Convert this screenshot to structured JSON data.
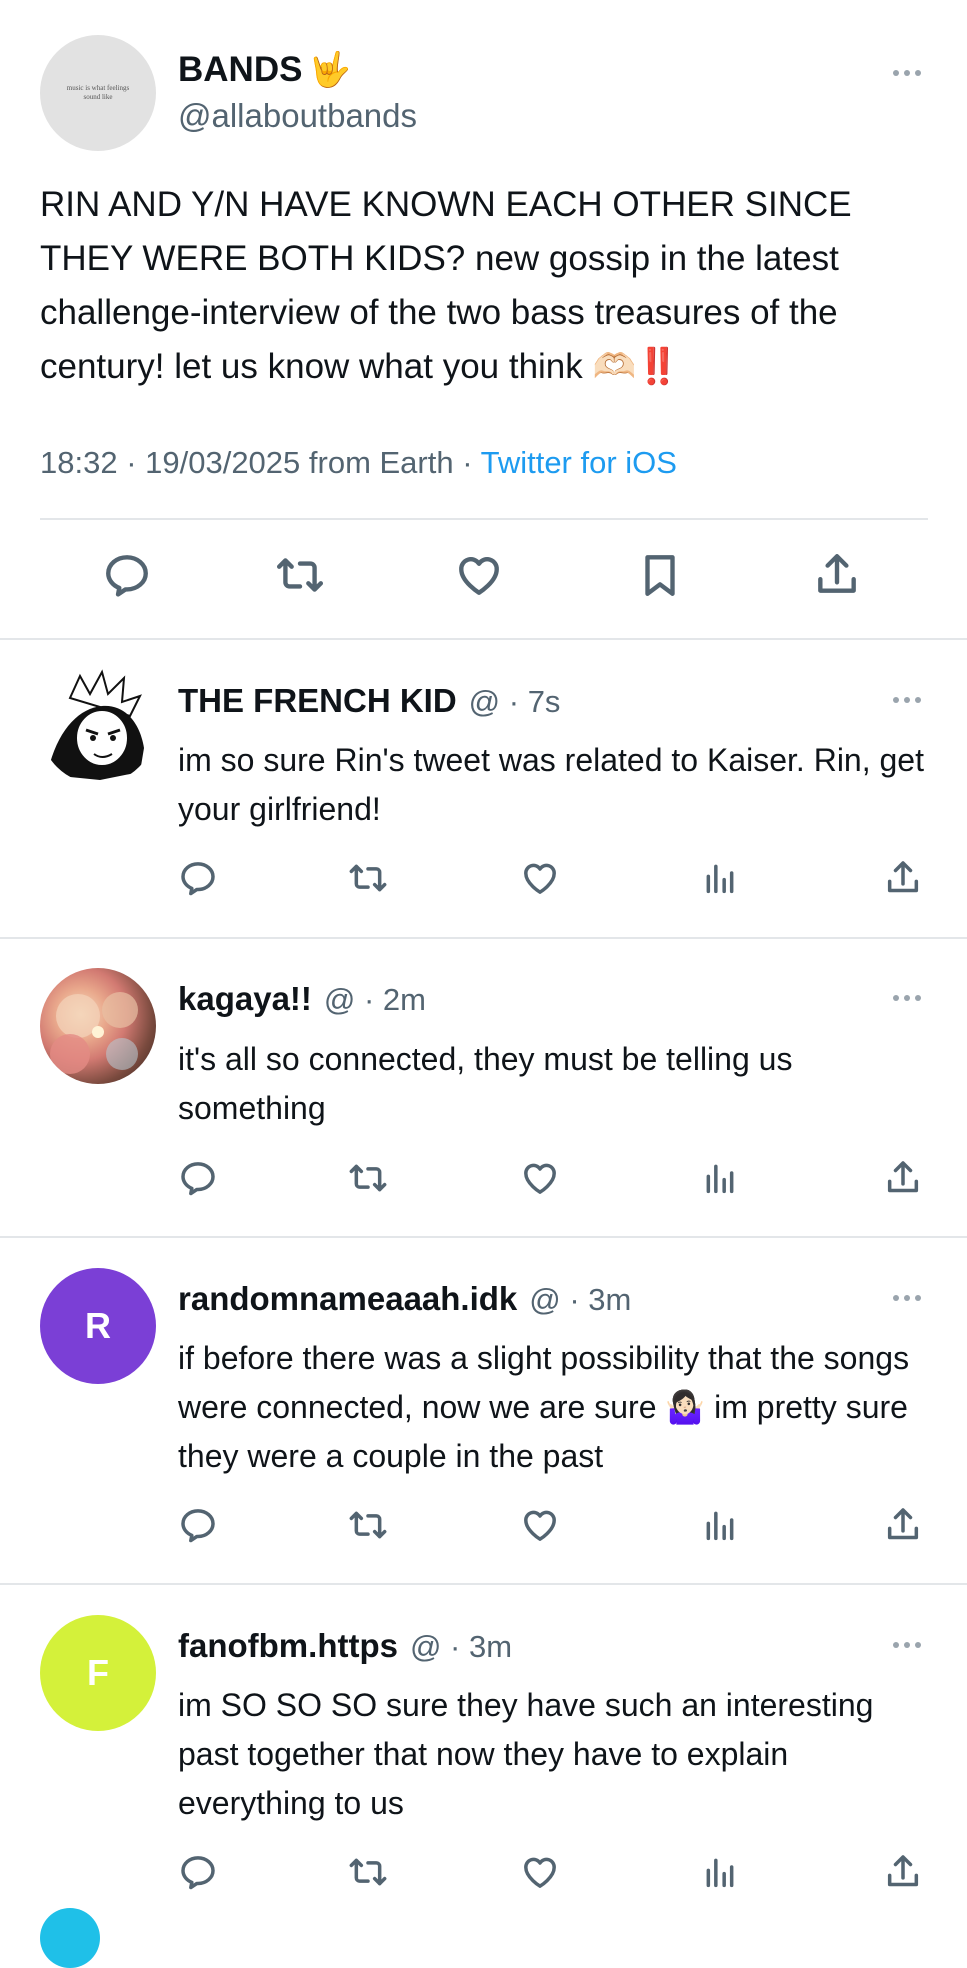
{
  "main_tweet": {
    "author_name": "BANDS",
    "author_emoji": "🤟",
    "handle": "@allaboutbands",
    "avatar_text": "music is what feelings sound like",
    "text": "RIN AND Y/N HAVE KNOWN EACH OTHER SINCE THEY WERE BOTH KIDS? new gossip in the latest challenge-interview of the two bass treasures of the century! let us know what you think 🫶🏻‼️",
    "timestamp": "18:32 · 19/03/2025 from Earth · ",
    "source": "Twitter for iOS",
    "actions": [
      "reply-icon",
      "retweet-icon",
      "like-icon",
      "bookmark-icon",
      "share-icon"
    ]
  },
  "replies": [
    {
      "name": "THE FRENCH KID",
      "meta": "@ · 7s",
      "text": "im so sure Rin's tweet was related to Kaiser. Rin, get your girlfriend!",
      "avatar_type": "manga-drawing"
    },
    {
      "name": "kagaya!!",
      "meta": "@ · 2m",
      "text": "it's all so connected, they must be telling us something",
      "avatar_type": "lanterns-photo"
    },
    {
      "name": "randomnameaaah.idk",
      "meta": "@ · 3m",
      "text": "if before there was a slight possibility that the songs were connected, now we are sure 🤷🏻‍♀️ im pretty sure they were a couple in the past",
      "avatar_letter": "R",
      "avatar_color": "#7b3fd6"
    },
    {
      "name": "fanofbm.https",
      "meta": "@ · 3m",
      "text": "im SO SO SO sure they have such an interesting past together that now they have to explain everything to us",
      "avatar_letter": "F",
      "avatar_color": "#d4f13a"
    }
  ],
  "colors": {
    "link": "#1d9bf0",
    "secondary_text": "#536471",
    "divider": "#e3e6e9"
  }
}
